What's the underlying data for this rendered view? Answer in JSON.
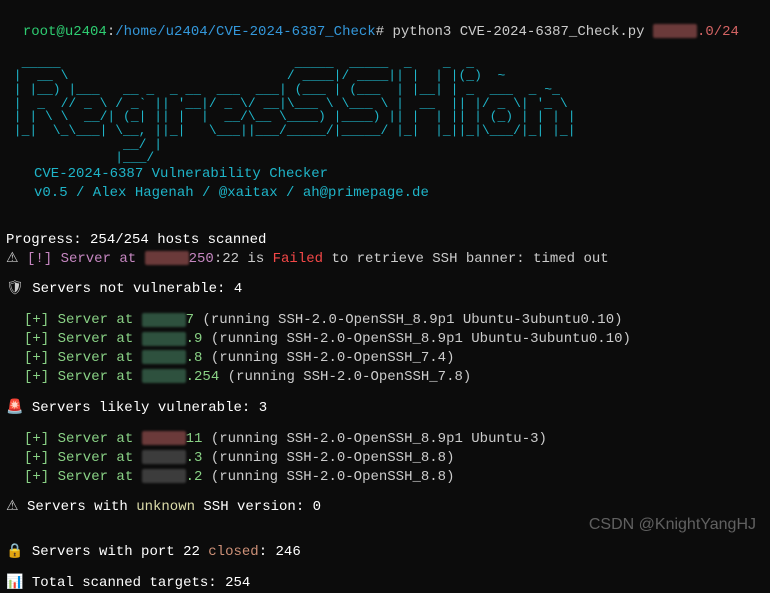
{
  "prompt": {
    "user_host": "root@u2404",
    "path": "/home/u2404/CVE-2024-6387_Check",
    "hash": "#",
    "command": "python3 CVE-2024-6387_Check.py ",
    "target_suffix": ".0/24"
  },
  "ascii_art": "  _____                              _____  _____  _    _  _\n |  __ \\                            / ____|/ ____|| |  | |(_)  ~\n | |__) |___   __ _  _ __  ___  ___| (___ | (___  | |__| | _  ___  _ ~_\n |  _  // _ \\ / _` || '__|/ _ \\/ __|\\___ \\ \\___ \\ |  __  || |/ _ \\| '_ \\\n | | \\ \\  __/| (_| || |  |  __/\\__ \\____) |____) || |  | || | (_) | | | |\n |_|  \\_\\___| \\__, ||_|   \\___||___/_____/|_____/ |_|  |_||_|\\___/|_| |_|\n               __/ |\n              |___/",
  "header": {
    "cve_line": "CVE-2024-6387 Vulnerability Checker",
    "version_line": "v0.5 / Alex Hagenah / @xaitax / ah@primepage.de"
  },
  "progress": {
    "label": "Progress: ",
    "value": "254/254 hosts scanned"
  },
  "failed": {
    "prefix": "[!] Server at ",
    "ip_last": "250",
    "port": ":22 is ",
    "status": "Failed",
    "suffix": " to retrieve SSH banner: timed out"
  },
  "sections": {
    "not_vulnerable": {
      "icon": "🛡",
      "label": "Servers not vulnerable: ",
      "count": "4",
      "items": [
        {
          "last": "7",
          "banner": " (running SSH-2.0-OpenSSH_8.9p1 Ubuntu-3ubuntu0.10)"
        },
        {
          "last": ".9",
          "banner": " (running SSH-2.0-OpenSSH_8.9p1 Ubuntu-3ubuntu0.10)"
        },
        {
          "last": ".8",
          "banner": " (running SSH-2.0-OpenSSH_7.4)"
        },
        {
          "last": ".254",
          "banner": " (running SSH-2.0-OpenSSH_7.8)"
        }
      ]
    },
    "vulnerable": {
      "icon": "🚨",
      "label": "Servers likely vulnerable: ",
      "count": "3",
      "items": [
        {
          "last": "11",
          "banner": " (running SSH-2.0-OpenSSH_8.9p1 Ubuntu-3)"
        },
        {
          "last": ".3",
          "banner": " (running SSH-2.0-OpenSSH_8.8)"
        },
        {
          "last": ".2",
          "banner": " (running SSH-2.0-OpenSSH_8.8)"
        }
      ]
    },
    "unknown": {
      "icon": "⚠",
      "label_pre": "Servers with ",
      "label_mid": "unknown",
      "label_post": " SSH version: ",
      "count": "0"
    },
    "closed": {
      "icon": "🔒",
      "label_pre": "Servers with port 22 ",
      "label_mid": "closed",
      "label_post": ": ",
      "count": "246"
    },
    "total": {
      "icon": "📊",
      "label": "Total scanned targets: ",
      "count": "254"
    }
  },
  "item_prefix": "[+] Server at ",
  "bullet_warn": "⚠",
  "watermark": "CSDN @KnightYangHJ"
}
